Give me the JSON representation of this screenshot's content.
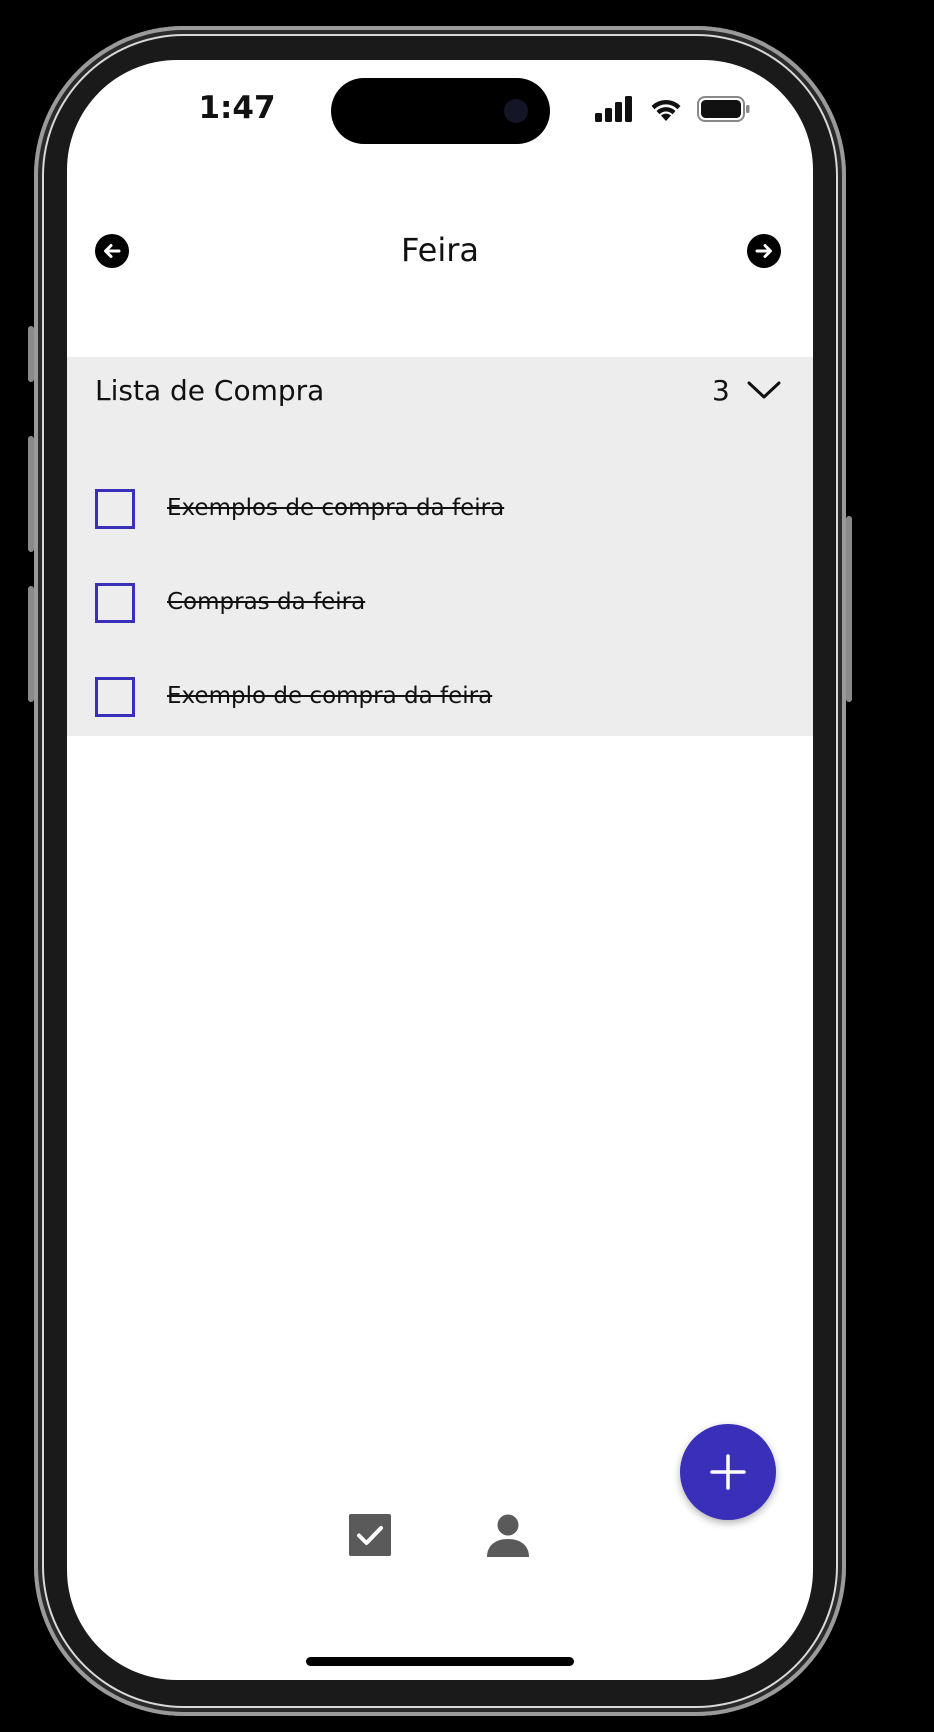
{
  "status_bar": {
    "time": "1:47"
  },
  "header": {
    "title": "Feira",
    "back_icon": "arrow-left-icon",
    "forward_icon": "arrow-right-icon"
  },
  "list_section": {
    "title": "Lista de Compra",
    "count": "3",
    "expanded_icon": "chevron-down-icon",
    "items": [
      {
        "label": "Exemplos de compra da feira",
        "checked": false,
        "struck_through": true
      },
      {
        "label": "Compras da feira",
        "checked": false,
        "struck_through": true
      },
      {
        "label": "Exemplo de compra da feira",
        "checked": false,
        "struck_through": true
      }
    ]
  },
  "fab": {
    "icon": "plus-icon"
  },
  "bottom_nav": [
    {
      "icon": "checkbox-checked-icon",
      "selected": true
    },
    {
      "icon": "person-icon",
      "selected": false
    }
  ],
  "colors": {
    "accent": "#3a2fb9",
    "section_background": "#ededed",
    "nav_icon": "#5a5a5a"
  }
}
